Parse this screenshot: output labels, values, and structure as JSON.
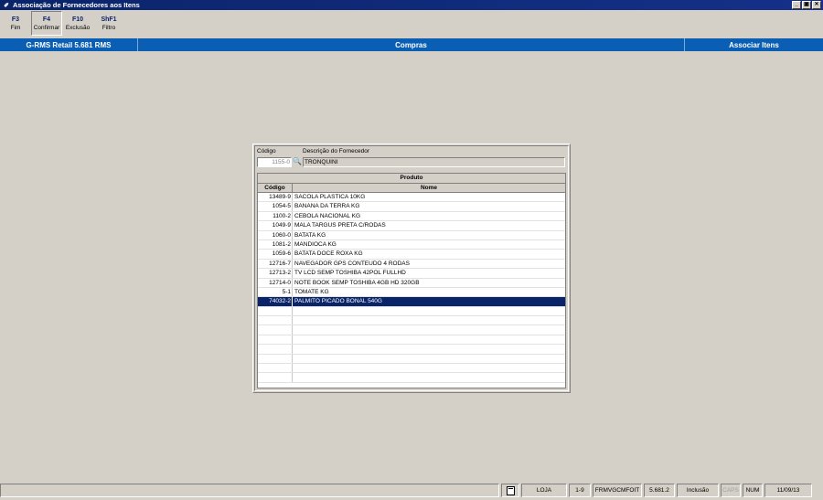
{
  "window": {
    "title": "Associação de Fornecedores aos Itens",
    "minimize": "_",
    "restore": "▣",
    "close": "✕"
  },
  "toolbar": [
    {
      "key": "F3",
      "label": "Fim"
    },
    {
      "key": "F4",
      "label": "Confirmar"
    },
    {
      "key": "F10",
      "label": "Exclusão"
    },
    {
      "key": "ShF1",
      "label": "Filtro"
    }
  ],
  "header": {
    "system": "G-RMS Retail 5.681 RMS",
    "module": "Compras",
    "function": "Associar Itens"
  },
  "form": {
    "codigo_label": "Código",
    "descricao_label": "Descrição do Fornecedor",
    "codigo_value": "1155-0",
    "descricao_value": "TRONQUINI"
  },
  "grid": {
    "group_title": "Produto",
    "columns": [
      "Código",
      "Nome"
    ],
    "rows": [
      {
        "code": "13489-9",
        "name": "SACOLA PLASTICA 10KG"
      },
      {
        "code": "1054-5",
        "name": "BANANA DA TERRA KG"
      },
      {
        "code": "1100-2",
        "name": "CEBOLA NACIONAL KG"
      },
      {
        "code": "1049-9",
        "name": "MALA TARGUS PRETA C/RODAS"
      },
      {
        "code": "1060-0",
        "name": "BATATA KG"
      },
      {
        "code": "1081-2",
        "name": "MANDIOCA KG"
      },
      {
        "code": "1059-6",
        "name": "BATATA DOCE ROXA KG"
      },
      {
        "code": "12716-7",
        "name": "NAVEGADOR GPS CONTEUDO 4 RODAS"
      },
      {
        "code": "12713-2",
        "name": "TV LCD SEMP TOSHIBA 42POL FULLHD"
      },
      {
        "code": "12714-0",
        "name": "NOTE BOOK SEMP TOSHIBA 4GB HD 320GB"
      },
      {
        "code": "5-1",
        "name": "TOMATE KG"
      },
      {
        "code": "74032-2",
        "name": "PALMITO PICADO BONAL 540G"
      }
    ]
  },
  "status": {
    "loja": "LOJA",
    "range": "1-9",
    "form": "FRMVGCMFOIT",
    "version": "5.681.2",
    "mode": "Inclusão",
    "caps": "CAPS",
    "num": "NUM",
    "date": "11/09/13"
  },
  "colors": {
    "titlebar": "#0a246a",
    "header": "#0a5fb4",
    "selection": "#0a246a",
    "background": "#d4d0c8"
  }
}
